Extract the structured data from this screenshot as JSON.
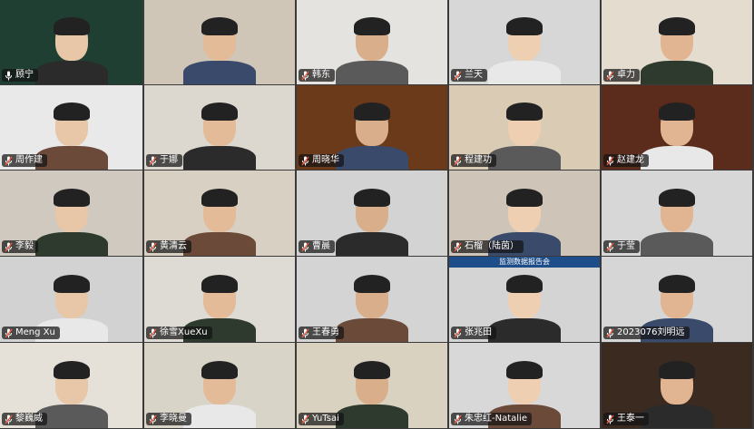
{
  "colors": {
    "name_tag_bg": "#141414",
    "mic_icon": "#ffffff",
    "mic_muted": "#ff5a3c"
  },
  "participants": [
    {
      "name": "顾宁",
      "muted": false,
      "bg": "#1f3f33"
    },
    {
      "name": "",
      "muted": false,
      "bg": "#cfc6b8"
    },
    {
      "name": "韩东",
      "muted": true,
      "bg": "#e5e3df"
    },
    {
      "name": "兰天",
      "muted": true,
      "bg": "#d6d7d6"
    },
    {
      "name": "卓力",
      "muted": true,
      "bg": "#e4dccf"
    },
    {
      "name": "周作建",
      "muted": true,
      "bg": "#e9e9ea"
    },
    {
      "name": "于娜",
      "muted": true,
      "bg": "#ddd8cf"
    },
    {
      "name": "周晓华",
      "muted": true,
      "bg": "#6b3a1b"
    },
    {
      "name": "程建功",
      "muted": true,
      "bg": "#d9cbb4"
    },
    {
      "name": "赵建龙",
      "muted": true,
      "bg": "#5b2b1b"
    },
    {
      "name": "李毅",
      "muted": true,
      "bg": "#cfc9bf"
    },
    {
      "name": "黄清云",
      "muted": true,
      "bg": "#d8d1c3"
    },
    {
      "name": "曹晨",
      "muted": true,
      "bg": "#d3d3d3"
    },
    {
      "name": "石榴（陆茵）",
      "muted": true,
      "bg": "#cfc4b8"
    },
    {
      "name": "于莹",
      "muted": true,
      "bg": "#d7d7d7"
    },
    {
      "name": "Meng Xu",
      "muted": true,
      "bg": "#d2d2d2"
    },
    {
      "name": "徐雪XueXu",
      "muted": true,
      "bg": "#dedbd5"
    },
    {
      "name": "王春勇",
      "muted": true,
      "bg": "#d4d4d4"
    },
    {
      "name": "张兆田",
      "muted": true,
      "bg": "#d4d4d4",
      "banner": "监测数据报告会"
    },
    {
      "name": "2023076刘明远",
      "muted": true,
      "bg": "#d6d6d6"
    },
    {
      "name": "黎巍威",
      "muted": true,
      "bg": "#e6e1d8"
    },
    {
      "name": "李晓曼",
      "muted": true,
      "bg": "#d9d4c8"
    },
    {
      "name": "YuTsai",
      "muted": true,
      "bg": "#d9d2c1"
    },
    {
      "name": "朱忠红-Natalie",
      "muted": true,
      "bg": "#d8d8d8"
    },
    {
      "name": "王泰一",
      "muted": true,
      "bg": "#3b2a20"
    }
  ]
}
